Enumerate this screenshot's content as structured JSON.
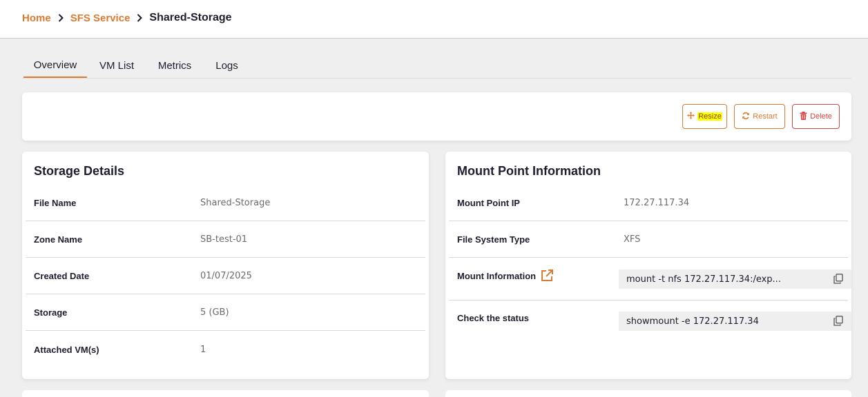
{
  "breadcrumb": {
    "home": "Home",
    "service": "SFS Service",
    "current": "Shared-Storage"
  },
  "tabs": [
    {
      "label": "Overview",
      "active": true
    },
    {
      "label": "VM List",
      "active": false
    },
    {
      "label": "Metrics",
      "active": false
    },
    {
      "label": "Logs",
      "active": false
    }
  ],
  "actions": {
    "resize": "Resize",
    "restart": "Restart",
    "delete": "Delete"
  },
  "storage_details": {
    "title": "Storage Details",
    "rows": [
      {
        "label": "File Name",
        "value": "Shared-Storage"
      },
      {
        "label": "Zone Name",
        "value": "SB-test-01"
      },
      {
        "label": "Created Date",
        "value": "01/07/2025"
      },
      {
        "label": "Storage",
        "value": "5 (GB)"
      },
      {
        "label": "Attached VM(s)",
        "value": "1"
      }
    ]
  },
  "mount_point": {
    "title": "Mount Point Information",
    "rows": [
      {
        "label": "Mount Point IP",
        "value": "172.27.117.34"
      },
      {
        "label": "File System Type",
        "value": "XFS"
      },
      {
        "label": "Mount Information",
        "value": "mount -t nfs 172.27.117.34:/exp..."
      },
      {
        "label": "Check the status",
        "value": "showmount -e 172.27.117.34"
      }
    ]
  },
  "colors": {
    "accent": "#dd7a31",
    "danger": "#d24545",
    "highlight": "#ffff00"
  },
  "icons": {
    "breadcrumb_separator": "chevron-right-icon",
    "resize": "move-arrows-icon",
    "restart": "refresh-icon",
    "delete": "trash-icon",
    "mount_info": "external-link-icon",
    "copy": "copy-icon"
  }
}
